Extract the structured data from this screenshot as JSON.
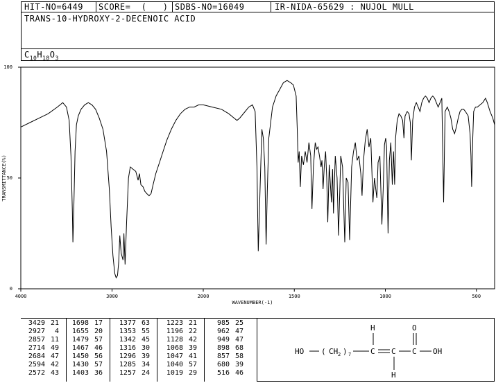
{
  "header": {
    "hit_no": "HIT-NO=6449",
    "score": "SCORE=  (   )",
    "sdbs_no": "SDBS-NO=16049",
    "ir_info": "IR-NIDA-65629 : NUJOL MULL",
    "compound_name": "TRANS-10-HYDROXY-2-DECENOIC ACID",
    "formula": {
      "c": "C",
      "c_n": "10",
      "h": "H",
      "h_n": "18",
      "o": "O",
      "o_n": "3"
    }
  },
  "chart_data": {
    "type": "line",
    "xlabel": "WAVENUMBER(-1)",
    "ylabel": "TRANSMITTANCE(%)",
    "xlim": [
      4000,
      400
    ],
    "ylim": [
      0,
      100
    ],
    "x_ticks": [
      4000,
      3000,
      2000,
      1500,
      1000,
      500
    ],
    "x_tick_labels": [
      "4000",
      "3000",
      "2000",
      "1500",
      "1000",
      "500"
    ],
    "y_ticks": [
      0,
      50,
      100
    ],
    "y_tick_labels": [
      "0",
      "50",
      "100"
    ],
    "series": [
      {
        "color": "#000000",
        "points": [
          [
            4000,
            73
          ],
          [
            3900,
            75
          ],
          [
            3800,
            77
          ],
          [
            3700,
            79
          ],
          [
            3600,
            82
          ],
          [
            3540,
            84
          ],
          [
            3500,
            82
          ],
          [
            3470,
            76
          ],
          [
            3450,
            60
          ],
          [
            3435,
            35
          ],
          [
            3429,
            21
          ],
          [
            3420,
            35
          ],
          [
            3405,
            62
          ],
          [
            3390,
            74
          ],
          [
            3370,
            78
          ],
          [
            3340,
            81
          ],
          [
            3300,
            83
          ],
          [
            3260,
            84
          ],
          [
            3220,
            83
          ],
          [
            3180,
            81
          ],
          [
            3140,
            77
          ],
          [
            3100,
            72
          ],
          [
            3060,
            62
          ],
          [
            3030,
            45
          ],
          [
            3010,
            28
          ],
          [
            2990,
            15
          ],
          [
            2970,
            7
          ],
          [
            2955,
            5
          ],
          [
            2940,
            6
          ],
          [
            2927,
            12
          ],
          [
            2915,
            24
          ],
          [
            2900,
            16
          ],
          [
            2880,
            13
          ],
          [
            2870,
            25
          ],
          [
            2857,
            11
          ],
          [
            2840,
            30
          ],
          [
            2820,
            50
          ],
          [
            2800,
            55
          ],
          [
            2770,
            54
          ],
          [
            2740,
            53
          ],
          [
            2714,
            49
          ],
          [
            2700,
            52
          ],
          [
            2684,
            47
          ],
          [
            2660,
            46
          ],
          [
            2640,
            44
          ],
          [
            2620,
            43
          ],
          [
            2594,
            42
          ],
          [
            2572,
            43
          ],
          [
            2550,
            47
          ],
          [
            2520,
            52
          ],
          [
            2480,
            57
          ],
          [
            2440,
            62
          ],
          [
            2400,
            67
          ],
          [
            2350,
            72
          ],
          [
            2300,
            76
          ],
          [
            2250,
            79
          ],
          [
            2200,
            81
          ],
          [
            2150,
            82
          ],
          [
            2100,
            82
          ],
          [
            2050,
            83
          ],
          [
            2000,
            83
          ],
          [
            1950,
            82
          ],
          [
            1900,
            81
          ],
          [
            1860,
            79
          ],
          [
            1830,
            77
          ],
          [
            1815,
            76
          ],
          [
            1800,
            77
          ],
          [
            1770,
            80
          ],
          [
            1750,
            82
          ],
          [
            1730,
            83
          ],
          [
            1715,
            80
          ],
          [
            1705,
            55
          ],
          [
            1698,
            17
          ],
          [
            1688,
            45
          ],
          [
            1678,
            72
          ],
          [
            1670,
            68
          ],
          [
            1662,
            55
          ],
          [
            1655,
            20
          ],
          [
            1648,
            45
          ],
          [
            1640,
            68
          ],
          [
            1620,
            82
          ],
          [
            1600,
            87
          ],
          [
            1580,
            90
          ],
          [
            1560,
            93
          ],
          [
            1540,
            94
          ],
          [
            1520,
            93
          ],
          [
            1505,
            92
          ],
          [
            1490,
            87
          ],
          [
            1484,
            72
          ],
          [
            1479,
            57
          ],
          [
            1473,
            62
          ],
          [
            1467,
            46
          ],
          [
            1460,
            60
          ],
          [
            1450,
            56
          ],
          [
            1440,
            62
          ],
          [
            1430,
            57
          ],
          [
            1420,
            66
          ],
          [
            1410,
            60
          ],
          [
            1403,
            36
          ],
          [
            1395,
            55
          ],
          [
            1385,
            66
          ],
          [
            1377,
            63
          ],
          [
            1370,
            64
          ],
          [
            1362,
            60
          ],
          [
            1353,
            55
          ],
          [
            1348,
            58
          ],
          [
            1342,
            45
          ],
          [
            1335,
            56
          ],
          [
            1328,
            62
          ],
          [
            1322,
            50
          ],
          [
            1316,
            30
          ],
          [
            1308,
            56
          ],
          [
            1296,
            39
          ],
          [
            1290,
            54
          ],
          [
            1285,
            34
          ],
          [
            1275,
            60
          ],
          [
            1265,
            50
          ],
          [
            1257,
            24
          ],
          [
            1250,
            45
          ],
          [
            1245,
            60
          ],
          [
            1235,
            55
          ],
          [
            1223,
            21
          ],
          [
            1215,
            50
          ],
          [
            1205,
            48
          ],
          [
            1196,
            22
          ],
          [
            1185,
            55
          ],
          [
            1175,
            62
          ],
          [
            1165,
            66
          ],
          [
            1155,
            58
          ],
          [
            1145,
            60
          ],
          [
            1135,
            52
          ],
          [
            1128,
            42
          ],
          [
            1120,
            58
          ],
          [
            1110,
            67
          ],
          [
            1100,
            72
          ],
          [
            1090,
            64
          ],
          [
            1080,
            68
          ],
          [
            1068,
            39
          ],
          [
            1060,
            50
          ],
          [
            1047,
            41
          ],
          [
            1040,
            57
          ],
          [
            1030,
            60
          ],
          [
            1019,
            29
          ],
          [
            1012,
            45
          ],
          [
            1005,
            65
          ],
          [
            998,
            68
          ],
          [
            993,
            64
          ],
          [
            985,
            25
          ],
          [
            978,
            58
          ],
          [
            970,
            66
          ],
          [
            962,
            47
          ],
          [
            955,
            62
          ],
          [
            949,
            47
          ],
          [
            944,
            68
          ],
          [
            935,
            76
          ],
          [
            925,
            79
          ],
          [
            915,
            78
          ],
          [
            905,
            76
          ],
          [
            898,
            68
          ],
          [
            892,
            78
          ],
          [
            880,
            80
          ],
          [
            870,
            79
          ],
          [
            863,
            75
          ],
          [
            857,
            58
          ],
          [
            850,
            76
          ],
          [
            840,
            82
          ],
          [
            830,
            84
          ],
          [
            820,
            82
          ],
          [
            810,
            80
          ],
          [
            800,
            84
          ],
          [
            790,
            86
          ],
          [
            780,
            87
          ],
          [
            770,
            86
          ],
          [
            760,
            84
          ],
          [
            750,
            86
          ],
          [
            740,
            87
          ],
          [
            730,
            86
          ],
          [
            720,
            84
          ],
          [
            710,
            82
          ],
          [
            700,
            84
          ],
          [
            690,
            86
          ],
          [
            680,
            39
          ],
          [
            672,
            80
          ],
          [
            660,
            82
          ],
          [
            650,
            80
          ],
          [
            640,
            77
          ],
          [
            630,
            72
          ],
          [
            620,
            70
          ],
          [
            610,
            73
          ],
          [
            600,
            77
          ],
          [
            590,
            80
          ],
          [
            580,
            81
          ],
          [
            570,
            81
          ],
          [
            560,
            80
          ],
          [
            545,
            78
          ],
          [
            535,
            70
          ],
          [
            530,
            60
          ],
          [
            526,
            46
          ],
          [
            520,
            68
          ],
          [
            515,
            80
          ],
          [
            505,
            82
          ],
          [
            495,
            82
          ],
          [
            480,
            83
          ],
          [
            465,
            84
          ],
          [
            450,
            86
          ],
          [
            440,
            84
          ],
          [
            425,
            80
          ],
          [
            410,
            77
          ],
          [
            400,
            74
          ]
        ]
      }
    ]
  },
  "peak_table": [
    [
      [
        "3429",
        "21"
      ],
      [
        "2927",
        "4"
      ],
      [
        "2857",
        "11"
      ],
      [
        "2714",
        "49"
      ],
      [
        "2684",
        "47"
      ],
      [
        "2594",
        "42"
      ],
      [
        "2572",
        "43"
      ]
    ],
    [
      [
        "1698",
        "17"
      ],
      [
        "1655",
        "20"
      ],
      [
        "1479",
        "57"
      ],
      [
        "1467",
        "46"
      ],
      [
        "1450",
        "56"
      ],
      [
        "1430",
        "57"
      ],
      [
        "1403",
        "36"
      ]
    ],
    [
      [
        "1377",
        "63"
      ],
      [
        "1353",
        "55"
      ],
      [
        "1342",
        "45"
      ],
      [
        "1316",
        "30"
      ],
      [
        "1296",
        "39"
      ],
      [
        "1285",
        "34"
      ],
      [
        "1257",
        "24"
      ]
    ],
    [
      [
        "1223",
        "21"
      ],
      [
        "1196",
        "22"
      ],
      [
        "1128",
        "42"
      ],
      [
        "1068",
        "39"
      ],
      [
        "1047",
        "41"
      ],
      [
        "1040",
        "57"
      ],
      [
        "1019",
        "29"
      ]
    ],
    [
      [
        "985",
        "25"
      ],
      [
        "962",
        "47"
      ],
      [
        "949",
        "47"
      ],
      [
        "898",
        "68"
      ],
      [
        "857",
        "58"
      ],
      [
        "680",
        "39"
      ],
      [
        "516",
        "46"
      ]
    ]
  ],
  "structure": {
    "ho": "HO",
    "lparen": "(",
    "ch2": "CH",
    "ch2_sub": "2",
    "rparen": ")",
    "n": "7",
    "c1": "C",
    "c2": "C",
    "c3": "C",
    "h_top": "H",
    "h_bottom": "H",
    "o_top": "O",
    "oh": "OH"
  }
}
